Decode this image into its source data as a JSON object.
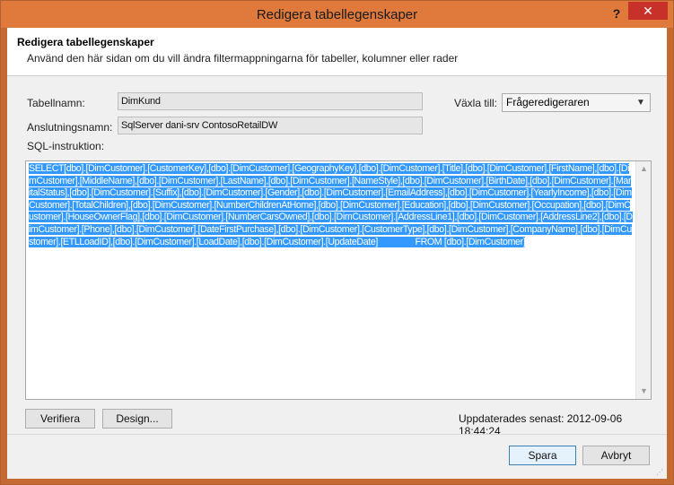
{
  "window": {
    "title": "Redigera tabellegenskaper",
    "help_glyph": "?",
    "close_glyph": "✕"
  },
  "header": {
    "title": "Redigera tabellegenskaper",
    "description": "Använd den här sidan om du vill ändra filtermappningarna för tabeller, kolumner eller rader"
  },
  "form": {
    "table_name_label": "Tabellnamn:",
    "table_name_value": "DimKund",
    "connection_label": "Anslutningsnamn:",
    "connection_value": "SqlServer dani-srv ContosoRetailDW",
    "switch_label": "Växla till:",
    "switch_value": "Frågeredigeraren",
    "sql_label": "SQL-instruktion:",
    "sql_text": "SELECT[dbo].[DimCustomer].[CustomerKey],[dbo].[DimCustomer].[GeographyKey],[dbo].[DimCustomer].[Title],[dbo].[DimCustomer].[FirstName],[dbo].[DimCustomer].[MiddleName],[dbo].[DimCustomer].[LastName],[dbo].[DimCustomer].[NameStyle],[dbo].[DimCustomer].[BirthDate],[dbo].[DimCustomer].[MaritalStatus],[dbo].[DimCustomer].[Suffix],[dbo].[DimCustomer].[Gender],[dbo].[DimCustomer].[EmailAddress],[dbo].[DimCustomer].[YearlyIncome],[dbo].[DimCustomer].[TotalChildren],[dbo].[DimCustomer].[NumberChildrenAtHome],[dbo].[DimCustomer].[Education],[dbo].[DimCustomer].[Occupation],[dbo].[DimCustomer].[HouseOwnerFlag],[dbo].[DimCustomer].[NumberCarsOwned],[dbo].[DimCustomer].[AddressLine1],[dbo].[DimCustomer].[AddressLine2],[dbo].[DimCustomer].[Phone],[dbo].[DimCustomer].[DateFirstPurchase],[dbo].[DimCustomer].[CustomerType],[dbo].[DimCustomer].[CompanyName],[dbo].[DimCustomer].[ETLLoadID],[dbo].[DimCustomer].[LoadDate],[dbo].[DimCustomer].[UpdateDate]                FROM [dbo].[DimCustomer]"
  },
  "actions": {
    "verify_label": "Verifiera",
    "design_label": "Design...",
    "updated_text": "Uppdaterades senast: 2012-09-06 18:44:24",
    "save_label": "Spara",
    "cancel_label": "Avbryt"
  },
  "colors": {
    "titlebar": "#e07a3c",
    "close_button": "#c7312a",
    "selection": "#3399ff"
  }
}
